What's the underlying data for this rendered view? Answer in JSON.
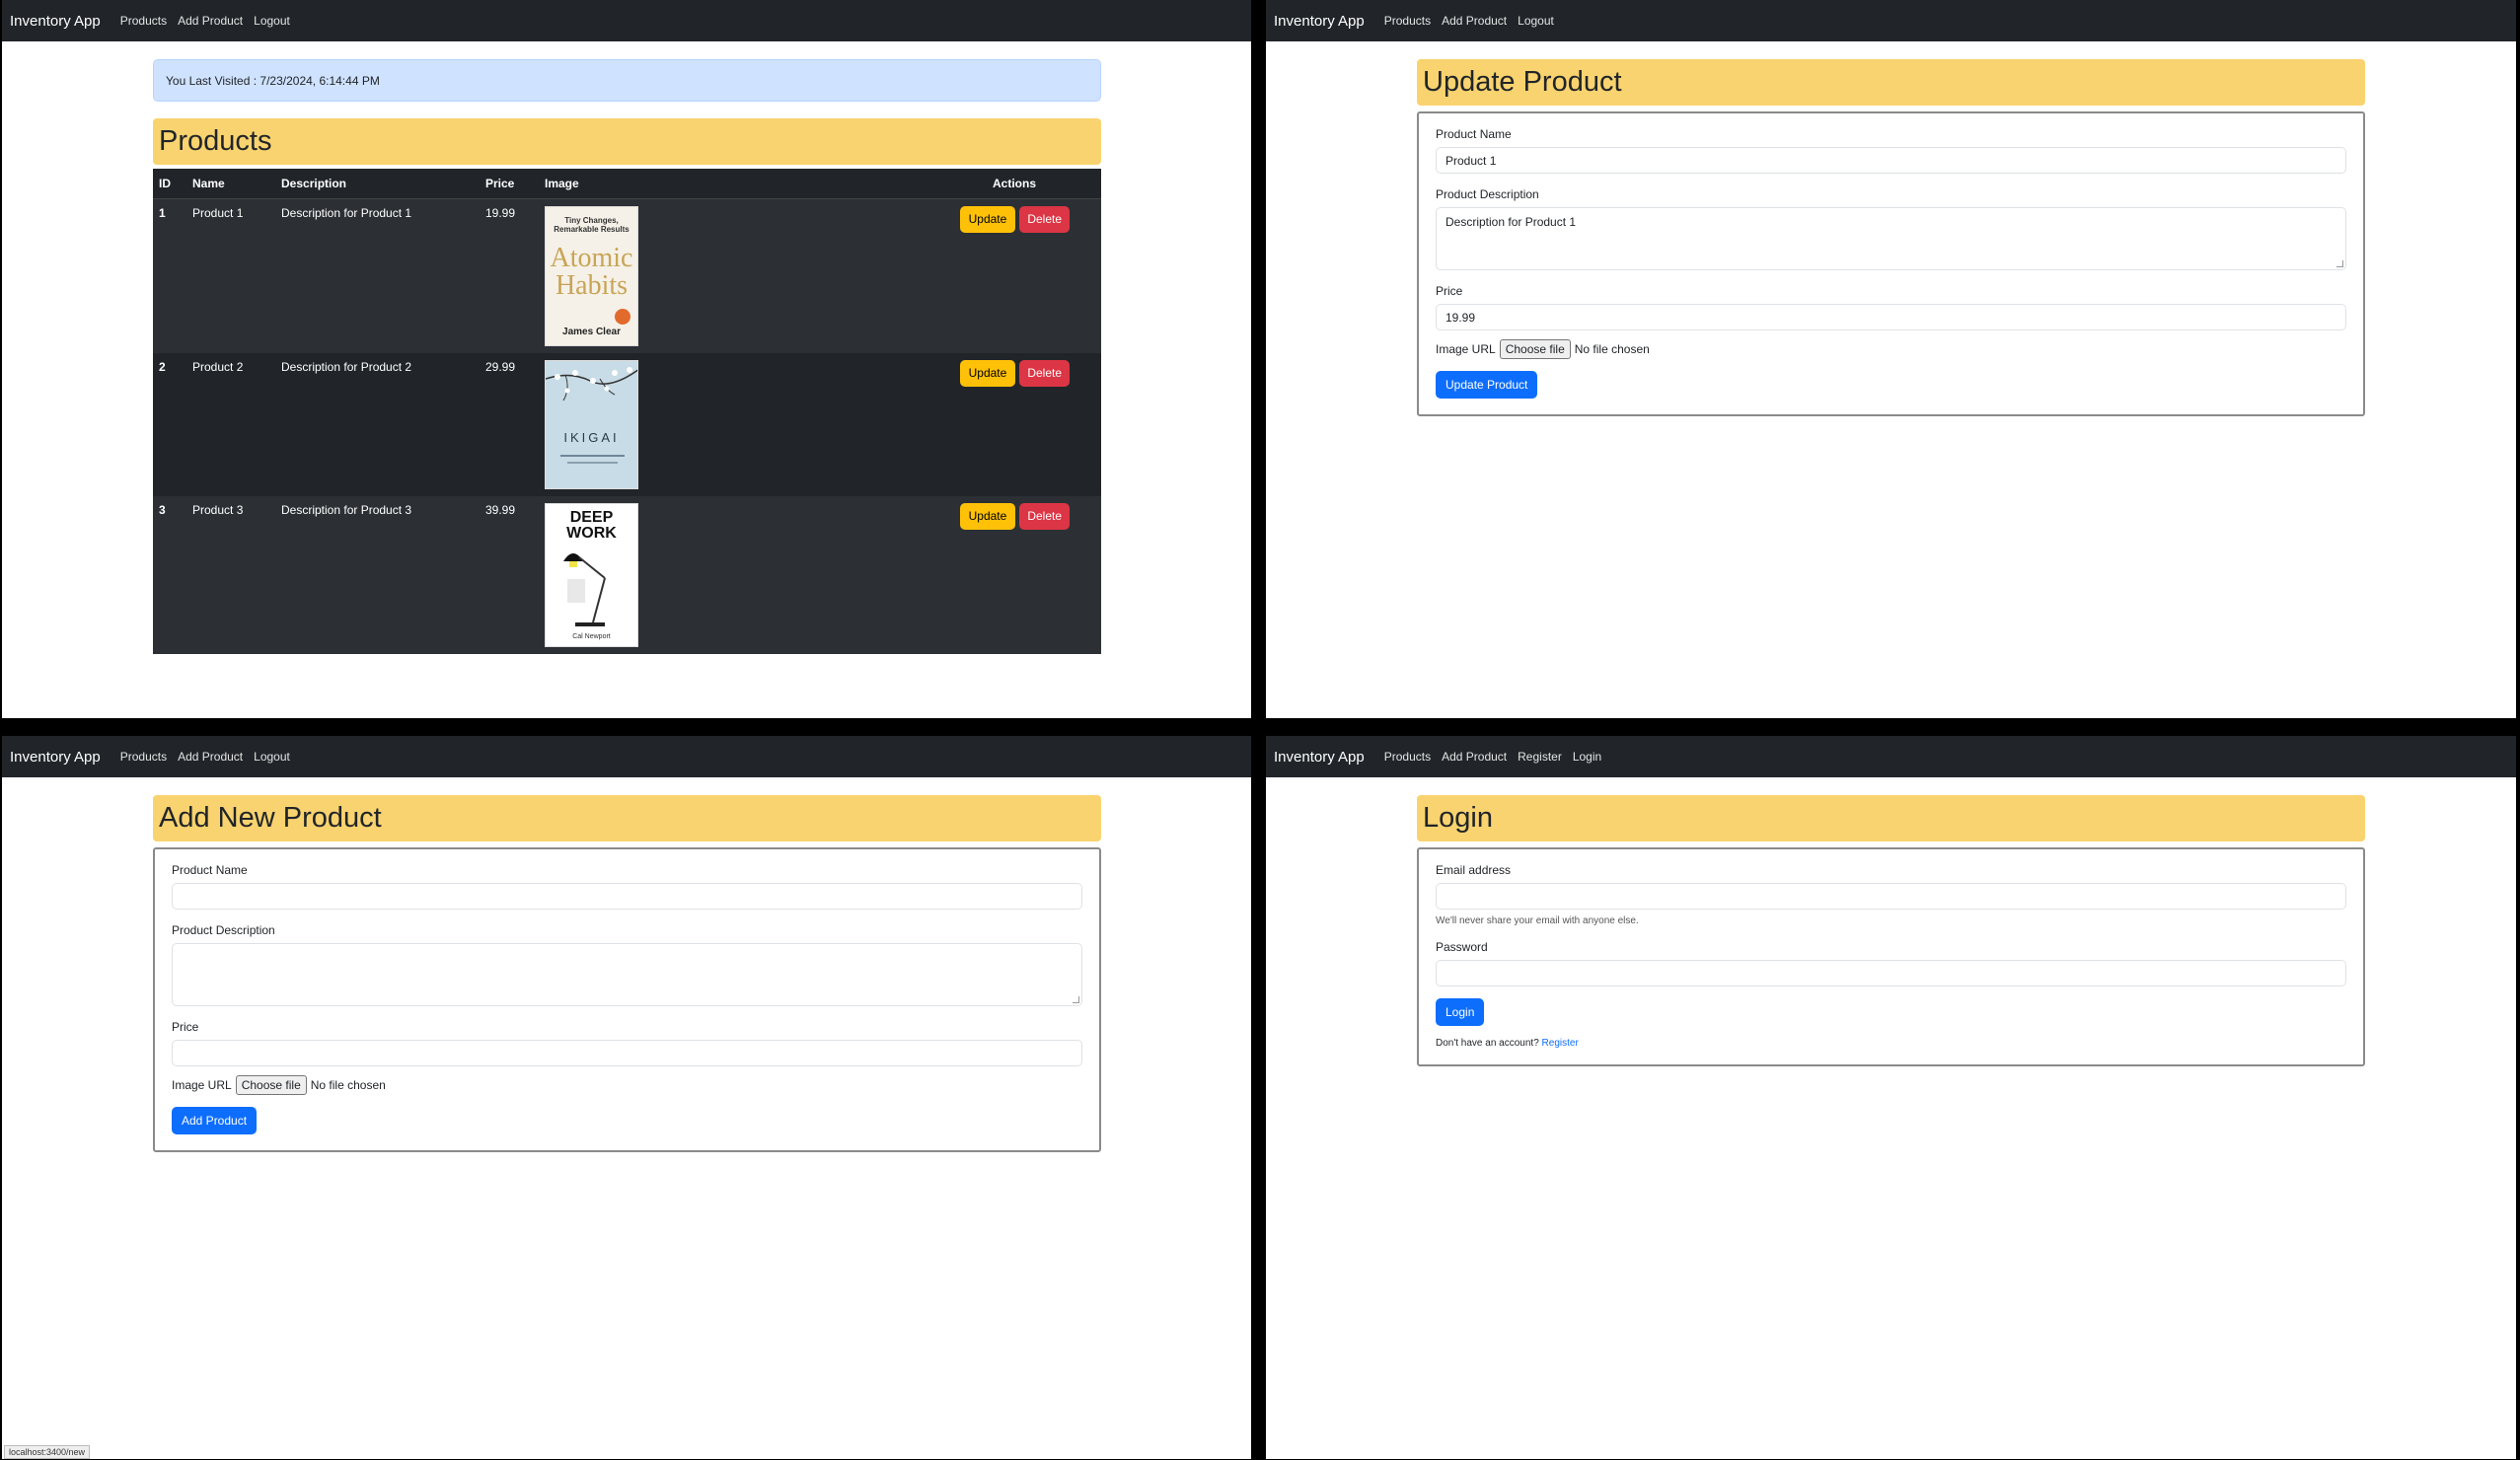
{
  "nav": {
    "brand": "Inventory App",
    "products": "Products",
    "add_product": "Add Product",
    "logout": "Logout",
    "register": "Register",
    "login": "Login"
  },
  "products_page": {
    "last_visited": "You Last Visited : 7/23/2024, 6:14:44 PM",
    "title": "Products",
    "columns": [
      "ID",
      "Name",
      "Description",
      "Price",
      "Image",
      "Actions"
    ],
    "rows": [
      {
        "id": "1",
        "name": "Product 1",
        "description": "Description for Product 1",
        "price": "19.99",
        "cover": {
          "top": "Tiny Changes, Remarkable Results",
          "title1": "Atomic",
          "title2": "Habits",
          "author": "James Clear"
        }
      },
      {
        "id": "2",
        "name": "Product 2",
        "description": "Description for Product 2",
        "price": "29.99",
        "cover": {
          "title": "IKIGAI"
        }
      },
      {
        "id": "3",
        "name": "Product 3",
        "description": "Description for Product 3",
        "price": "39.99",
        "cover": {
          "title1": "DEEP",
          "title2": "WORK",
          "author": "Cal Newport"
        }
      }
    ],
    "update_label": "Update",
    "delete_label": "Delete"
  },
  "update_page": {
    "title": "Update Product",
    "name_label": "Product Name",
    "name_value": "Product 1",
    "desc_label": "Product Description",
    "desc_value": "Description for Product 1",
    "price_label": "Price",
    "price_value": "19.99",
    "image_label": "Image URL",
    "choose_file": "Choose file",
    "no_file": "No file chosen",
    "submit": "Update Product"
  },
  "add_page": {
    "title": "Add New Product",
    "name_label": "Product Name",
    "desc_label": "Product Description",
    "price_label": "Price",
    "image_label": "Image URL",
    "choose_file": "Choose file",
    "no_file": "No file chosen",
    "submit": "Add Product"
  },
  "login_page": {
    "title": "Login",
    "email_label": "Email address",
    "email_help": "We'll never share your email with anyone else.",
    "password_label": "Password",
    "submit": "Login",
    "no_account": "Don't have an account?",
    "register_link": "Register"
  },
  "status_bar": "localhost:3400/new",
  "colors": {
    "navbar": "#212529",
    "heading": "#f9d36f",
    "primary": "#0d6efd",
    "warning": "#ffc107",
    "danger": "#dc3545",
    "alert": "#cfe2ff"
  }
}
